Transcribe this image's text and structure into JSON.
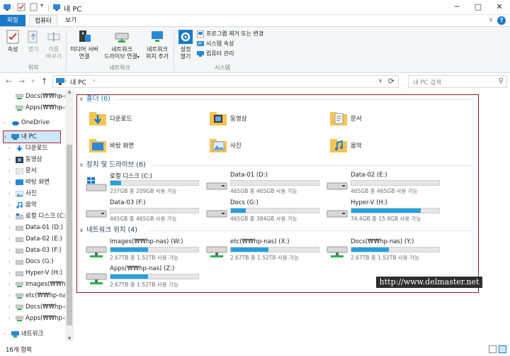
{
  "window": {
    "title": "내 PC",
    "minimize": "─",
    "maximize": "□",
    "close": "✕"
  },
  "tabs": {
    "file": "파일",
    "computer": "컴퓨터",
    "view": "보기",
    "help": "?"
  },
  "ribbon": {
    "location": {
      "label": "위치",
      "properties": "속성",
      "open": "열기",
      "rename": [
        "이름",
        "바꾸기"
      ]
    },
    "network": {
      "label": "네트워크",
      "media_server": [
        "미디어 서버",
        "연결"
      ],
      "network_drive": [
        "네트워크",
        "드라이브 연결"
      ],
      "add_network_location": [
        "네트워크",
        "위치 추가"
      ]
    },
    "system": {
      "label": "시스템",
      "settings": [
        "설정",
        "열기"
      ],
      "uninstall": "프로그램 제거 또는 변경",
      "system_properties": "시스템 속성",
      "manage": "컴퓨터 관리"
    }
  },
  "address": {
    "path": "내 PC",
    "separator": "›",
    "search_placeholder": "내 PC 검색"
  },
  "sidebar": {
    "items": [
      {
        "label": "Docs(₩₩hp-r",
        "pinned": true
      },
      {
        "label": "Apps(₩₩hp-r",
        "pinned": true
      },
      {
        "label": "OneDrive"
      },
      {
        "label": "내 PC"
      },
      {
        "label": "다운로드"
      },
      {
        "label": "동영상"
      },
      {
        "label": "문서"
      },
      {
        "label": "바탕 화면"
      },
      {
        "label": "사진"
      },
      {
        "label": "음악"
      },
      {
        "label": "로컬 디스크 (C:)"
      },
      {
        "label": "Data-01 (D:)"
      },
      {
        "label": "Data-02 (E:)"
      },
      {
        "label": "Data-03 (F:)"
      },
      {
        "label": "Docs (G:)"
      },
      {
        "label": "Hyper-V (H:)"
      },
      {
        "label": "Images(₩₩hp-na"
      },
      {
        "label": "etc(₩₩hp-nas) ("
      },
      {
        "label": "Docs(₩₩hp-nas"
      },
      {
        "label": "Apps(₩₩hp-nas"
      },
      {
        "label": "네트워크"
      }
    ]
  },
  "sections": {
    "folders": {
      "title": "폴더 (6)",
      "items": [
        "다운로드",
        "동영상",
        "문서",
        "바탕 화면",
        "사진",
        "음악"
      ]
    },
    "drives": {
      "title": "장치 및 드라이브 (6)",
      "items": [
        {
          "name": "로컬 디스크 (C:)",
          "info": "237GB 중 209GB 사용 가능",
          "used": 0.12
        },
        {
          "name": "Data-01 (D:)",
          "info": "465GB 중 465GB 사용 가능",
          "used": 0.0
        },
        {
          "name": "Data-02 (E:)",
          "info": "465GB 중 465GB 사용 가능",
          "used": 0.0
        },
        {
          "name": "Data-03 (F:)",
          "info": "465GB 중 465GB 사용 가능",
          "used": 0.0
        },
        {
          "name": "Docs (G:)",
          "info": "465GB 중 384GB 사용 가능",
          "used": 0.17
        },
        {
          "name": "Hyper-V (H:)",
          "info": "74.4GB 중 15.9GB 사용 가능",
          "used": 0.79
        }
      ]
    },
    "network": {
      "title": "네트워크 위치 (4)",
      "items": [
        {
          "name": "Images(₩₩hp-nas) (W:)",
          "info": "2.67TB 중 1.52TB 사용 가능",
          "used": 0.43
        },
        {
          "name": "etc(₩₩hp-nas) (X:)",
          "info": "2.67TB 중 1.52TB 사용 가능",
          "used": 0.43
        },
        {
          "name": "Docs(₩₩hp-nas) (Y:)",
          "info": "2.67TB 중 1.52TB 사용 가능",
          "used": 0.43
        },
        {
          "name": "Apps(₩₩hp-nas) (Z:)",
          "info": "2.67TB 중 1.52TB 사용 가능",
          "used": 0.43
        }
      ]
    }
  },
  "watermark": "http://www.delmaster.net",
  "status": {
    "count": "16개 항목"
  },
  "colors": {
    "accent": "#1979ca",
    "bar_fill": "#26a0da",
    "highlight_border": "#8b1a22"
  }
}
